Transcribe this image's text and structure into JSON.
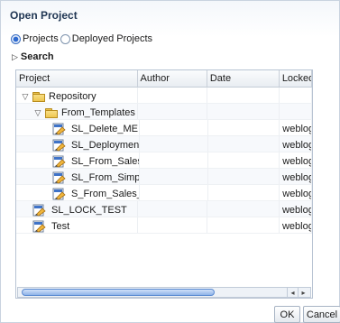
{
  "dialog": {
    "title": "Open Project"
  },
  "radios": [
    {
      "label": "Projects",
      "selected": true
    },
    {
      "label": "Deployed Projects",
      "selected": false
    }
  ],
  "search": {
    "label": "Search",
    "expander": "▷"
  },
  "columns": [
    "Project",
    "Author",
    "Date",
    "Locked"
  ],
  "rows": [
    {
      "level": 0,
      "type": "folder",
      "expander": "▽",
      "name": "Repository",
      "author": "",
      "date": "",
      "locked": ""
    },
    {
      "level": 1,
      "type": "folder",
      "expander": "▽",
      "name": "From_Templates",
      "author": "",
      "date": "",
      "locked": ""
    },
    {
      "level": 2,
      "type": "project",
      "name": "SL_Delete_ME",
      "author": "",
      "date": "",
      "locked": "weblog"
    },
    {
      "level": 2,
      "type": "project",
      "name": "SL_Deployment_Opti",
      "author": "",
      "date": "",
      "locked": "weblog"
    },
    {
      "level": 2,
      "type": "project",
      "name": "SL_From_Sales_Quot",
      "author": "",
      "date": "",
      "locked": "weblog"
    },
    {
      "level": 2,
      "type": "project",
      "name": "SL_From_Simple_Tes",
      "author": "",
      "date": "",
      "locked": "weblog"
    },
    {
      "level": 2,
      "type": "project",
      "name": "S_From_Sales_Quote",
      "author": "",
      "date": "",
      "locked": "weblog"
    },
    {
      "level": 1,
      "type": "project",
      "name": "SL_LOCK_TEST",
      "author": "",
      "date": "",
      "locked": "weblog"
    },
    {
      "level": 1,
      "type": "project",
      "name": "Test",
      "author": "",
      "date": "",
      "locked": "weblog"
    }
  ],
  "scrollbar": {
    "left_arrow": "◂",
    "right_arrow": "▸"
  },
  "buttons": {
    "ok": "OK",
    "cancel": "Cancel"
  }
}
